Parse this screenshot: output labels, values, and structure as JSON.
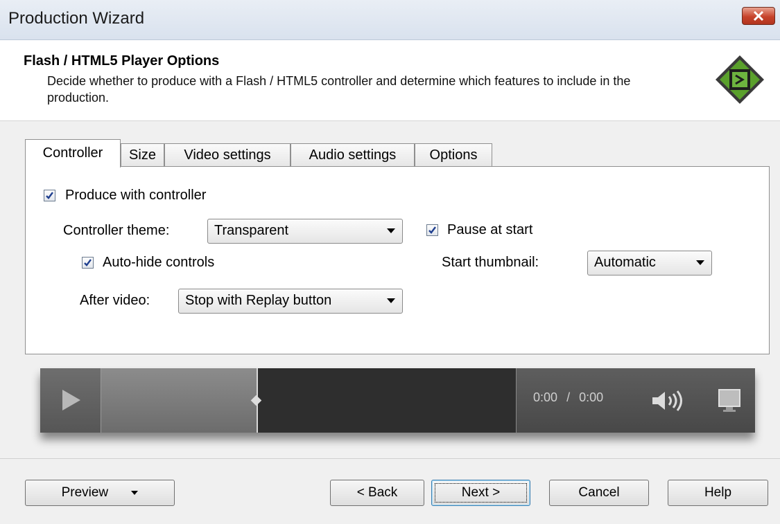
{
  "window": {
    "title": "Production Wizard",
    "close_label": "x"
  },
  "header": {
    "title": "Flash / HTML5 Player Options",
    "description": "Decide whether to produce with a Flash / HTML5 controller and determine which features to include in the production.",
    "logo_icon": "camtasia-logo-icon"
  },
  "tabs": [
    {
      "label": "Controller",
      "active": true
    },
    {
      "label": "Size"
    },
    {
      "label": "Video settings"
    },
    {
      "label": "Audio settings"
    },
    {
      "label": "Options"
    }
  ],
  "controller": {
    "produce_with_controller": {
      "label": "Produce with controller",
      "checked": true
    },
    "theme": {
      "label": "Controller theme:",
      "value": "Transparent"
    },
    "auto_hide": {
      "label": "Auto-hide controls",
      "checked": true
    },
    "after_video": {
      "label": "After video:",
      "value": "Stop with Replay button"
    },
    "pause_at_start": {
      "label": "Pause at start",
      "checked": true
    },
    "start_thumbnail": {
      "label": "Start thumbnail:",
      "value": "Automatic"
    }
  },
  "player_preview": {
    "time_current": "0:00",
    "time_separator": "/",
    "time_total": "0:00",
    "seek_progress": 0.45
  },
  "buttons": {
    "preview": "Preview",
    "back": "< Back",
    "next": "Next >",
    "cancel": "Cancel",
    "help": "Help"
  },
  "colors": {
    "close_button": "#c7432b",
    "player_dark": "#2e2e2e"
  }
}
